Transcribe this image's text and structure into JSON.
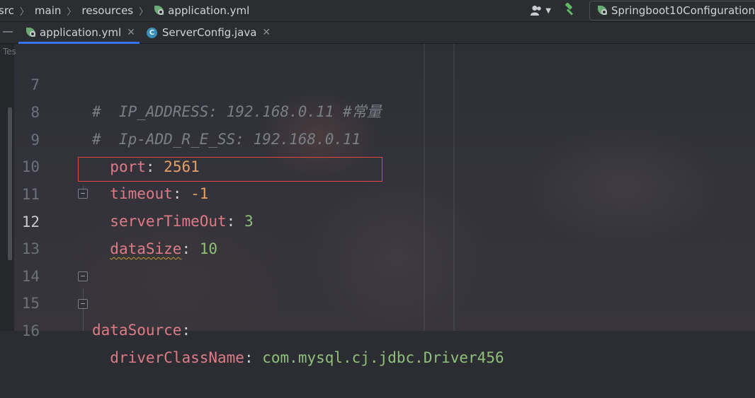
{
  "navbar": {
    "breadcrumbs": [
      "src",
      "main",
      "resources",
      "application.yml"
    ],
    "run_config": "Springboot10Configuration"
  },
  "tabs": [
    {
      "label": "application.yml",
      "icon": "spring-yml-icon",
      "active": true
    },
    {
      "label": "ServerConfig.java",
      "icon": "java-class-icon",
      "active": false
    }
  ],
  "sidebar": {
    "label": "Tes"
  },
  "editor": {
    "lines": [
      {
        "number": "7",
        "comment": "#  IP_ADDRESS: 192.168.0.11 #常量"
      },
      {
        "number": "8",
        "comment": "#  Ip-ADD_R_E_SS: 192.168.0.11"
      },
      {
        "number": "9",
        "indent": "  ",
        "key": "port",
        "value": "2561"
      },
      {
        "number": "10",
        "indent": "  ",
        "key": "timeout",
        "value": "-1"
      },
      {
        "number": "11",
        "indent": "  ",
        "key": "serverTimeOut",
        "value": "3"
      },
      {
        "number": "12",
        "indent": "  ",
        "key": "dataSize",
        "value": "10"
      },
      {
        "number": "13"
      },
      {
        "number": "14"
      },
      {
        "number": "15",
        "key": "dataSource"
      },
      {
        "number": "16",
        "indent": "  ",
        "key": "driverClassName",
        "value": "com.mysql.cj.jdbc.Driver456"
      }
    ],
    "current_line": "12",
    "highlighted_line": "11"
  },
  "colors": {
    "key": "#de7b86",
    "number": "#e3a062",
    "string": "#8fc07a",
    "comment": "#7a7e85",
    "highlight_border": "#e0473f",
    "active_tab_underline": "#3574f0"
  }
}
